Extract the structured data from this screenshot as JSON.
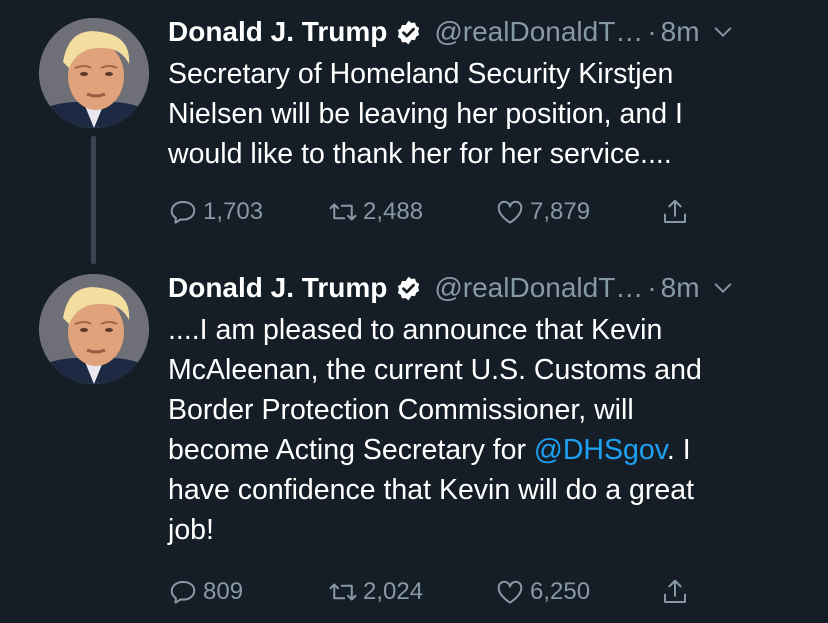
{
  "tweets": [
    {
      "author_name": "Donald J. Trump",
      "handle": "@realDonaldT…",
      "separator": "·",
      "time": "8m",
      "text_lines": [
        "Secretary of Homeland Security Kirstjen",
        "Nielsen will be leaving her position, and I",
        "would like to thank her for her service...."
      ],
      "replies": "1,703",
      "retweets": "2,488",
      "likes": "7,879"
    },
    {
      "author_name": "Donald J. Trump",
      "handle": "@realDonaldT…",
      "separator": "·",
      "time": "8m",
      "text_lines": [
        "....I am pleased to announce that Kevin",
        "McAleenan, the current U.S. Customs and",
        "Border Protection Commissioner, will",
        "become Acting Secretary for ",
        "have confidence that Kevin will do a great",
        "job!"
      ],
      "mention": "@DHSgov",
      "after_mention": ". I",
      "replies": "809",
      "retweets": "2,024",
      "likes": "6,250"
    }
  ],
  "icons": {
    "verified": "verified-badge-icon",
    "caret": "chevron-down-icon",
    "reply": "reply-icon",
    "retweet": "retweet-icon",
    "like": "heart-icon",
    "share": "share-icon"
  },
  "colors": {
    "background": "#151d26",
    "text": "#ffffff",
    "muted": "#8899a6",
    "link": "#1da1f2",
    "thread_line": "#3a4552"
  }
}
